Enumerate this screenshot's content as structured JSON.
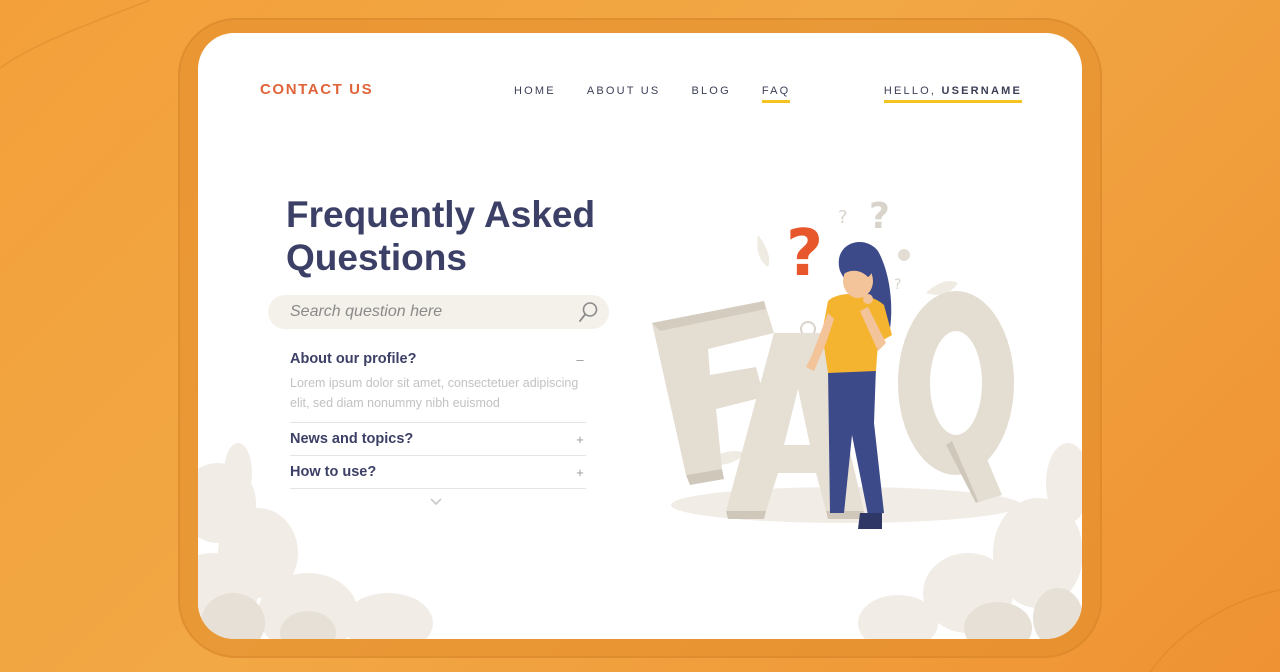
{
  "nav": {
    "brand": "CONTACT US",
    "links": [
      {
        "label": "HOME",
        "active": false
      },
      {
        "label": "ABOUT US",
        "active": false
      },
      {
        "label": "BLOG",
        "active": false
      },
      {
        "label": "FAQ",
        "active": true
      }
    ],
    "greeting": "HELLO,",
    "username": "USERNAME"
  },
  "hero": {
    "title_line1": "Frequently Asked",
    "title_line2": "Questions"
  },
  "search": {
    "placeholder": "Search question here",
    "icon": "search-icon"
  },
  "faq": {
    "items": [
      {
        "question": "About our profile?",
        "expanded": true,
        "toggle": "–",
        "answer": "Lorem ipsum dolor sit amet, consectetuer adipiscing elit, sed diam nonummy nibh euismod"
      },
      {
        "question": "News and topics?",
        "expanded": false,
        "toggle": "+"
      },
      {
        "question": "How to use?",
        "expanded": false,
        "toggle": "+"
      }
    ],
    "more_icon": "chevron-down-icon"
  },
  "illustration": {
    "letters": "FAQ",
    "icon": "faq-illustration"
  },
  "colors": {
    "brand": "#e0643a",
    "heading": "#3c4066",
    "accent_underline": "#f5c320",
    "background": "#f3a03a"
  }
}
